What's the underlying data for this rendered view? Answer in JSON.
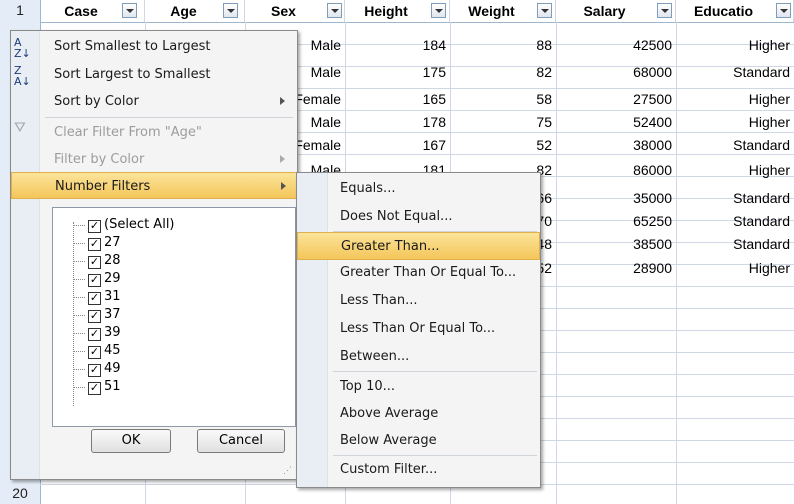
{
  "row_numbers": {
    "top": "1",
    "bottom": "20"
  },
  "columns": [
    {
      "label": "Case"
    },
    {
      "label": "Age"
    },
    {
      "label": "Sex"
    },
    {
      "label": "Height"
    },
    {
      "label": "Weight"
    },
    {
      "label": "Salary"
    },
    {
      "label": "Educatio"
    }
  ],
  "rows": [
    {
      "sex": "Male",
      "height": "184",
      "weight": "88",
      "salary": "42500",
      "education": "Higher"
    },
    {
      "sex": "Male",
      "height": "175",
      "weight": "82",
      "salary": "68000",
      "education": "Standard"
    },
    {
      "sex": "Female",
      "height": "165",
      "weight": "58",
      "salary": "27500",
      "education": "Higher"
    },
    {
      "sex": "Male",
      "height": "178",
      "weight": "75",
      "salary": "52400",
      "education": "Higher"
    },
    {
      "sex": "Female",
      "height": "167",
      "weight": "52",
      "salary": "38000",
      "education": "Standard"
    },
    {
      "sex": "Male",
      "height": "181",
      "weight": "82",
      "salary": "86000",
      "education": "Higher"
    },
    {
      "sex": "",
      "height": "",
      "weight": "66",
      "salary": "35000",
      "education": "Standard"
    },
    {
      "sex": "",
      "height": "",
      "weight": "70",
      "salary": "65250",
      "education": "Standard"
    },
    {
      "sex": "",
      "height": "",
      "weight": "48",
      "salary": "38500",
      "education": "Standard"
    },
    {
      "sex": "",
      "height": "",
      "weight": "52",
      "salary": "28900",
      "education": "Higher"
    }
  ],
  "filter_menu": {
    "sort_asc": "Sort Smallest to Largest",
    "sort_desc": "Sort Largest to Smallest",
    "sort_color": "Sort by Color",
    "clear_filter": "Clear Filter From \"Age\"",
    "filter_color": "Filter by Color",
    "number_filters": "Number Filters",
    "icons": {
      "sort_asc": "sort-ascending-icon",
      "sort_desc": "sort-descending-icon",
      "clear": "clear-filter-icon"
    },
    "checklist": [
      "(Select All)",
      "27",
      "28",
      "29",
      "31",
      "37",
      "39",
      "45",
      "49",
      "51"
    ],
    "ok": "OK",
    "cancel": "Cancel"
  },
  "number_filters_menu": [
    "Equals...",
    "Does Not Equal...",
    "Greater Than...",
    "Greater Than Or Equal To...",
    "Less Than...",
    "Less Than Or Equal To...",
    "Between...",
    "Top 10...",
    "Above Average",
    "Below Average",
    "Custom Filter..."
  ],
  "highlighted": {
    "menu": "Number Filters",
    "submenu": "Greater Than..."
  },
  "colors": {
    "highlight": "#f4c65a",
    "header_bg": "#e4ecf7",
    "gridline": "#d0d7e5"
  }
}
